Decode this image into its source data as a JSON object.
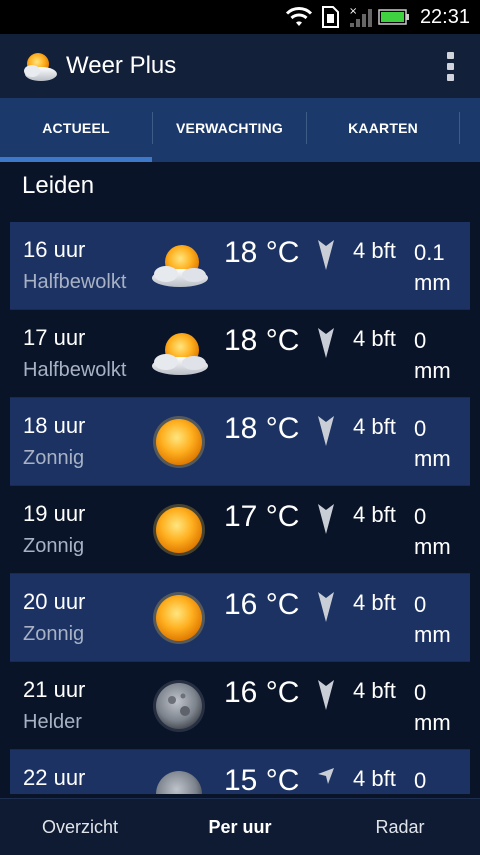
{
  "status_bar": {
    "time": "22:31"
  },
  "app": {
    "title": "Weer Plus"
  },
  "tabs": [
    {
      "label": "ACTUEEL",
      "selected": true
    },
    {
      "label": "VERWACHTING",
      "selected": false
    },
    {
      "label": "KAARTEN",
      "selected": false
    }
  ],
  "location": "Leiden",
  "forecast": [
    {
      "hour": "16 uur",
      "condition": "Halfbewolkt",
      "icon": "partly-cloudy-icon",
      "temp": "18 °C",
      "wind": "4 bft",
      "rain": "0.1 mm"
    },
    {
      "hour": "17 uur",
      "condition": "Halfbewolkt",
      "icon": "partly-cloudy-icon",
      "temp": "18 °C",
      "wind": "4 bft",
      "rain": "0 mm"
    },
    {
      "hour": "18 uur",
      "condition": "Zonnig",
      "icon": "sun-icon",
      "temp": "18 °C",
      "wind": "4 bft",
      "rain": "0 mm"
    },
    {
      "hour": "19 uur",
      "condition": "Zonnig",
      "icon": "sun-icon",
      "temp": "17 °C",
      "wind": "4 bft",
      "rain": "0 mm"
    },
    {
      "hour": "20 uur",
      "condition": "Zonnig",
      "icon": "sun-icon",
      "temp": "16 °C",
      "wind": "4 bft",
      "rain": "0 mm"
    },
    {
      "hour": "21 uur",
      "condition": "Helder",
      "icon": "moon-icon",
      "temp": "16 °C",
      "wind": "4 bft",
      "rain": "0 mm"
    },
    {
      "hour": "22 uur",
      "condition": "",
      "icon": "moon-icon",
      "temp": "15 °C",
      "wind": "4 bft",
      "rain": "0"
    }
  ],
  "bottom_nav": [
    {
      "label": "Overzicht",
      "selected": false
    },
    {
      "label": "Per uur",
      "selected": true
    },
    {
      "label": "Radar",
      "selected": false
    }
  ],
  "colors": {
    "background": "#0a1428",
    "row_highlight": "#1c3263",
    "tab_bar": "#1b3a6b",
    "tab_indicator": "#3e78c8",
    "battery": "#3fd13f"
  }
}
